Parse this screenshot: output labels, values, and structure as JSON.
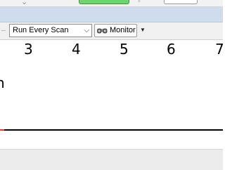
{
  "toolbar": {
    "scan_mode": "Run Every Scan",
    "monitor_label": "Monitor"
  },
  "ruler": {
    "ticks": [
      "3",
      "4",
      "5",
      "6",
      "7"
    ]
  },
  "left_edge_char": "n",
  "colors": {
    "band_blue": "#cfdced",
    "status_green": "#6fd46f",
    "marker_red": "#e83a3a"
  },
  "icons": [
    "chevron-down-icon",
    "binoculars-icon",
    "dropdown-arrow-icon"
  ]
}
